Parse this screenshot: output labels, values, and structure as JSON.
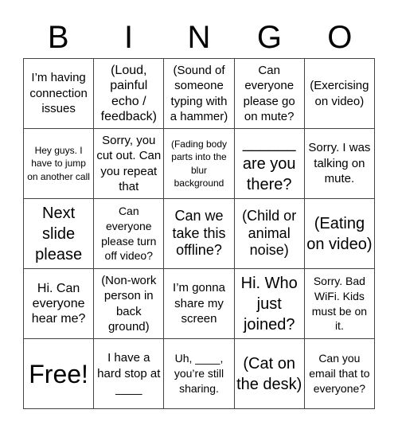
{
  "title_letters": [
    "B",
    "I",
    "N",
    "G",
    "O"
  ],
  "rows": [
    [
      {
        "text": "I’m having connection issues",
        "size": "s15"
      },
      {
        "text": "(Loud, painful echo / feedback)",
        "size": "s16"
      },
      {
        "text": "(Sound of someone typing with a hammer)",
        "size": "s15"
      },
      {
        "text": "Can everyone please go on mute?",
        "size": "s15"
      },
      {
        "text": "(Exercising on video)",
        "size": "s15"
      }
    ],
    [
      {
        "text": "Hey guys. I have to jump on another call",
        "size": "s12"
      },
      {
        "text": "Sorry, you cut out. Can you repeat that",
        "size": "s15"
      },
      {
        "text": "(Fading body parts into the blur background",
        "size": "s12"
      },
      {
        "text": "______ are you there?",
        "size": "s20"
      },
      {
        "text": "Sorry. I was talking on mute.",
        "size": "s15"
      }
    ],
    [
      {
        "text": "Next slide please",
        "size": "s20"
      },
      {
        "text": "Can everyone please turn off video?",
        "size": "s14"
      },
      {
        "text": "Can we take this offline?",
        "size": "s18"
      },
      {
        "text": "(Child or animal noise)",
        "size": "s18"
      },
      {
        "text": "(Eating on video)",
        "size": "s20"
      }
    ],
    [
      {
        "text": "Hi. Can everyone hear me?",
        "size": "s16"
      },
      {
        "text": "(Non-work person in back ground)",
        "size": "s15"
      },
      {
        "text": "I’m gonna share my screen",
        "size": "s15"
      },
      {
        "text": "Hi. Who just joined?",
        "size": "s20"
      },
      {
        "text": "Sorry. Bad WiFi. Kids must be on it.",
        "size": "s14"
      }
    ],
    [
      {
        "text": "Free!",
        "size": "s32"
      },
      {
        "text": "I have a hard stop at ____",
        "size": "s15"
      },
      {
        "text": "Uh, ____, you’re still sharing.",
        "size": "s14"
      },
      {
        "text": "(Cat on the desk)",
        "size": "s20"
      },
      {
        "text": "Can you email that to everyone?",
        "size": "s14"
      }
    ]
  ]
}
